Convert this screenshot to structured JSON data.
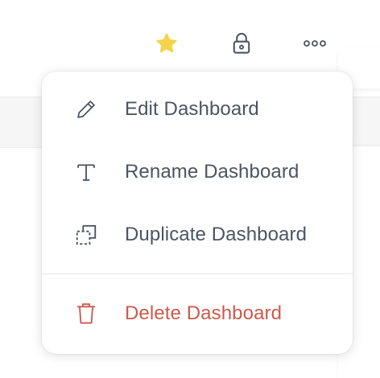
{
  "toolbar": {
    "star_icon": "star-icon",
    "lock_icon": "lock-icon",
    "more_icon": "more-horizontal-icon",
    "star_color": "#F5D44B"
  },
  "menu": {
    "items": [
      {
        "label": "Edit Dashboard",
        "icon": "pencil-icon"
      },
      {
        "label": "Rename Dashboard",
        "icon": "text-icon"
      },
      {
        "label": "Duplicate Dashboard",
        "icon": "duplicate-icon"
      }
    ],
    "danger_item": {
      "label": "Delete Dashboard",
      "icon": "trash-icon",
      "color": "#CD5A4D"
    }
  }
}
